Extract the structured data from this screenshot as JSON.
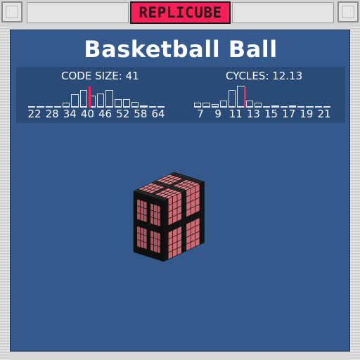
{
  "window": {
    "title": "REPLICUBE",
    "accent": "#ff1f58",
    "frame_color": "#d8d8d8"
  },
  "puzzle": {
    "name": "Basketball Ball",
    "panel_color": "#34598d"
  },
  "stats": {
    "code_size": {
      "label": "CODE SIZE: 41",
      "value": 41,
      "ticks": [
        "22",
        "28",
        "34",
        "40",
        "46",
        "52",
        "58",
        "64"
      ],
      "histogram": [
        0.02,
        0.02,
        0.04,
        0.05,
        0.2,
        0.55,
        0.75,
        0.5,
        0.6,
        0.75,
        0.35,
        0.35,
        0.25,
        0.1,
        0.04,
        0.02
      ]
    },
    "cycles": {
      "label": "CYCLES: 12.13",
      "value": 12.13,
      "ticks": [
        "7",
        "9",
        "11",
        "13",
        "15",
        "17",
        "19",
        "21"
      ],
      "histogram": [
        0.2,
        0.2,
        0.15,
        0.3,
        0.75,
        0.9,
        0.3,
        0.2,
        0.05,
        0.08,
        0.05,
        0.08,
        0.04,
        0.04,
        0.03,
        0.02
      ]
    }
  },
  "cube": {
    "icon": "voxel-cube-icon",
    "colors": {
      "stripe": "#141414",
      "ball": "#c86b72",
      "top_stripe": "#2a2a2a",
      "top_ball": "#d07a80"
    }
  }
}
